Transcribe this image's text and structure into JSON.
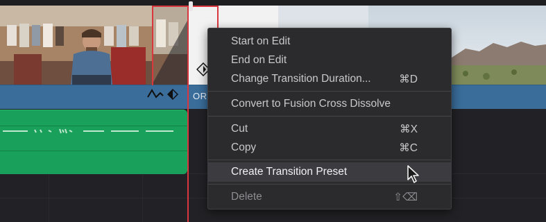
{
  "timeline": {
    "clip_label": "OR",
    "colors": {
      "clip_bar": "#3a6d9a",
      "audio_clip": "#19a05a",
      "selection": "#d9363e",
      "menu_bg": "#2b2b2e"
    },
    "icons": [
      "transition-curve-icon",
      "keyframe-diamond-icon",
      "transition-marker-icon",
      "playhead-icon"
    ]
  },
  "context_menu": {
    "items": [
      {
        "label": "Start on Edit",
        "shortcut": "",
        "enabled": true
      },
      {
        "label": "End on Edit",
        "shortcut": "",
        "enabled": true
      },
      {
        "label": "Change Transition Duration...",
        "shortcut": "⌘D",
        "enabled": true
      },
      {
        "label": "Convert to Fusion Cross Dissolve",
        "shortcut": "",
        "enabled": true
      },
      {
        "label": "Cut",
        "shortcut": "⌘X",
        "enabled": true
      },
      {
        "label": "Copy",
        "shortcut": "⌘C",
        "enabled": true
      },
      {
        "label": "Create Transition Preset",
        "shortcut": "",
        "enabled": true,
        "highlighted": true
      },
      {
        "label": "Delete",
        "shortcut": "⇧⌫",
        "enabled": false
      }
    ]
  }
}
